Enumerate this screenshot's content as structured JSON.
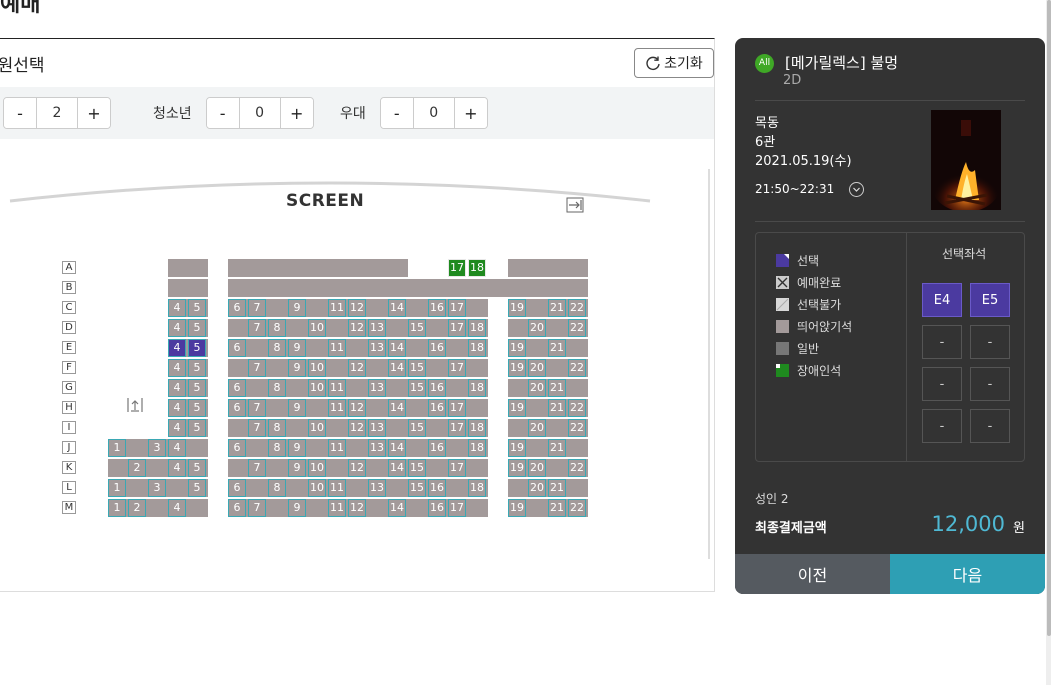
{
  "page": {
    "title": "예매"
  },
  "seat_panel": {
    "title": "인원선택",
    "reset_label": "초기화",
    "counters": [
      {
        "label": "",
        "value": "2",
        "minus": "-",
        "plus": "+"
      },
      {
        "label": "청소년",
        "value": "0",
        "minus": "-",
        "plus": "+"
      },
      {
        "label": "우대",
        "value": "0",
        "minus": "-",
        "plus": "+"
      }
    ],
    "screen_label": "SCREEN",
    "rows": [
      "A",
      "B",
      "C",
      "D",
      "E",
      "F",
      "G",
      "H",
      "I",
      "J",
      "K",
      "L",
      "M"
    ],
    "seats": {
      "A": {
        "handicap": [
          "17",
          "18"
        ]
      },
      "C": [
        "4",
        "5",
        "6",
        "7",
        "9",
        "11",
        "12",
        "14",
        "16",
        "17",
        "19",
        "21",
        "22"
      ],
      "D": [
        "4",
        "5",
        "7",
        "8",
        "10",
        "12",
        "13",
        "15",
        "17",
        "18",
        "20",
        "22"
      ],
      "E": [
        "4",
        "5",
        "6",
        "8",
        "9",
        "11",
        "13",
        "14",
        "16",
        "18",
        "19",
        "21"
      ],
      "F": [
        "4",
        "5",
        "7",
        "9",
        "10",
        "12",
        "14",
        "15",
        "17",
        "19",
        "20",
        "22"
      ],
      "G": [
        "4",
        "5",
        "6",
        "8",
        "10",
        "11",
        "13",
        "15",
        "16",
        "18",
        "20",
        "21"
      ],
      "H": [
        "4",
        "5",
        "6",
        "7",
        "9",
        "11",
        "12",
        "14",
        "16",
        "17",
        "19",
        "21",
        "22"
      ],
      "I": [
        "4",
        "5",
        "7",
        "8",
        "10",
        "12",
        "13",
        "15",
        "17",
        "18",
        "20",
        "22"
      ],
      "J": [
        "1",
        "3",
        "4",
        "6",
        "8",
        "9",
        "11",
        "13",
        "14",
        "16",
        "18",
        "19",
        "21"
      ],
      "K": [
        "2",
        "4",
        "5",
        "7",
        "9",
        "10",
        "12",
        "14",
        "15",
        "17",
        "19",
        "20",
        "22"
      ],
      "L": [
        "1",
        "3",
        "5",
        "6",
        "8",
        "10",
        "11",
        "13",
        "15",
        "16",
        "18",
        "20",
        "21"
      ],
      "M": [
        "1",
        "2",
        "4",
        "6",
        "7",
        "9",
        "11",
        "12",
        "14",
        "16",
        "17",
        "19",
        "21",
        "22"
      ]
    },
    "selected": [
      "E4",
      "E5"
    ]
  },
  "summary": {
    "rating": "All",
    "movie_title": "[메가릴렉스] 불멍",
    "format": "2D",
    "theater": "목동",
    "hall": "6관",
    "date": "2021.05.19(수)",
    "time": "21:50~22:31",
    "legend": [
      {
        "label": "선택",
        "color": "#4b3aa0"
      },
      {
        "label": "예매완료",
        "color": "#cccccc"
      },
      {
        "label": "선택불가",
        "color": "#d8d8d8"
      },
      {
        "label": "띄어앉기석",
        "color": "#a39a9a"
      },
      {
        "label": "일반",
        "color": "#777777"
      },
      {
        "label": "장애인석",
        "color": "#1f8a1f"
      }
    ],
    "selected_title": "선택좌석",
    "selected_slots": [
      "E4",
      "E5",
      "-",
      "-",
      "-",
      "-",
      "-",
      "-"
    ],
    "person_count": "성인 2",
    "total_label": "최종결제금액",
    "total_price": "12,000",
    "currency": "원",
    "prev_label": "이전",
    "next_label": "다음"
  }
}
